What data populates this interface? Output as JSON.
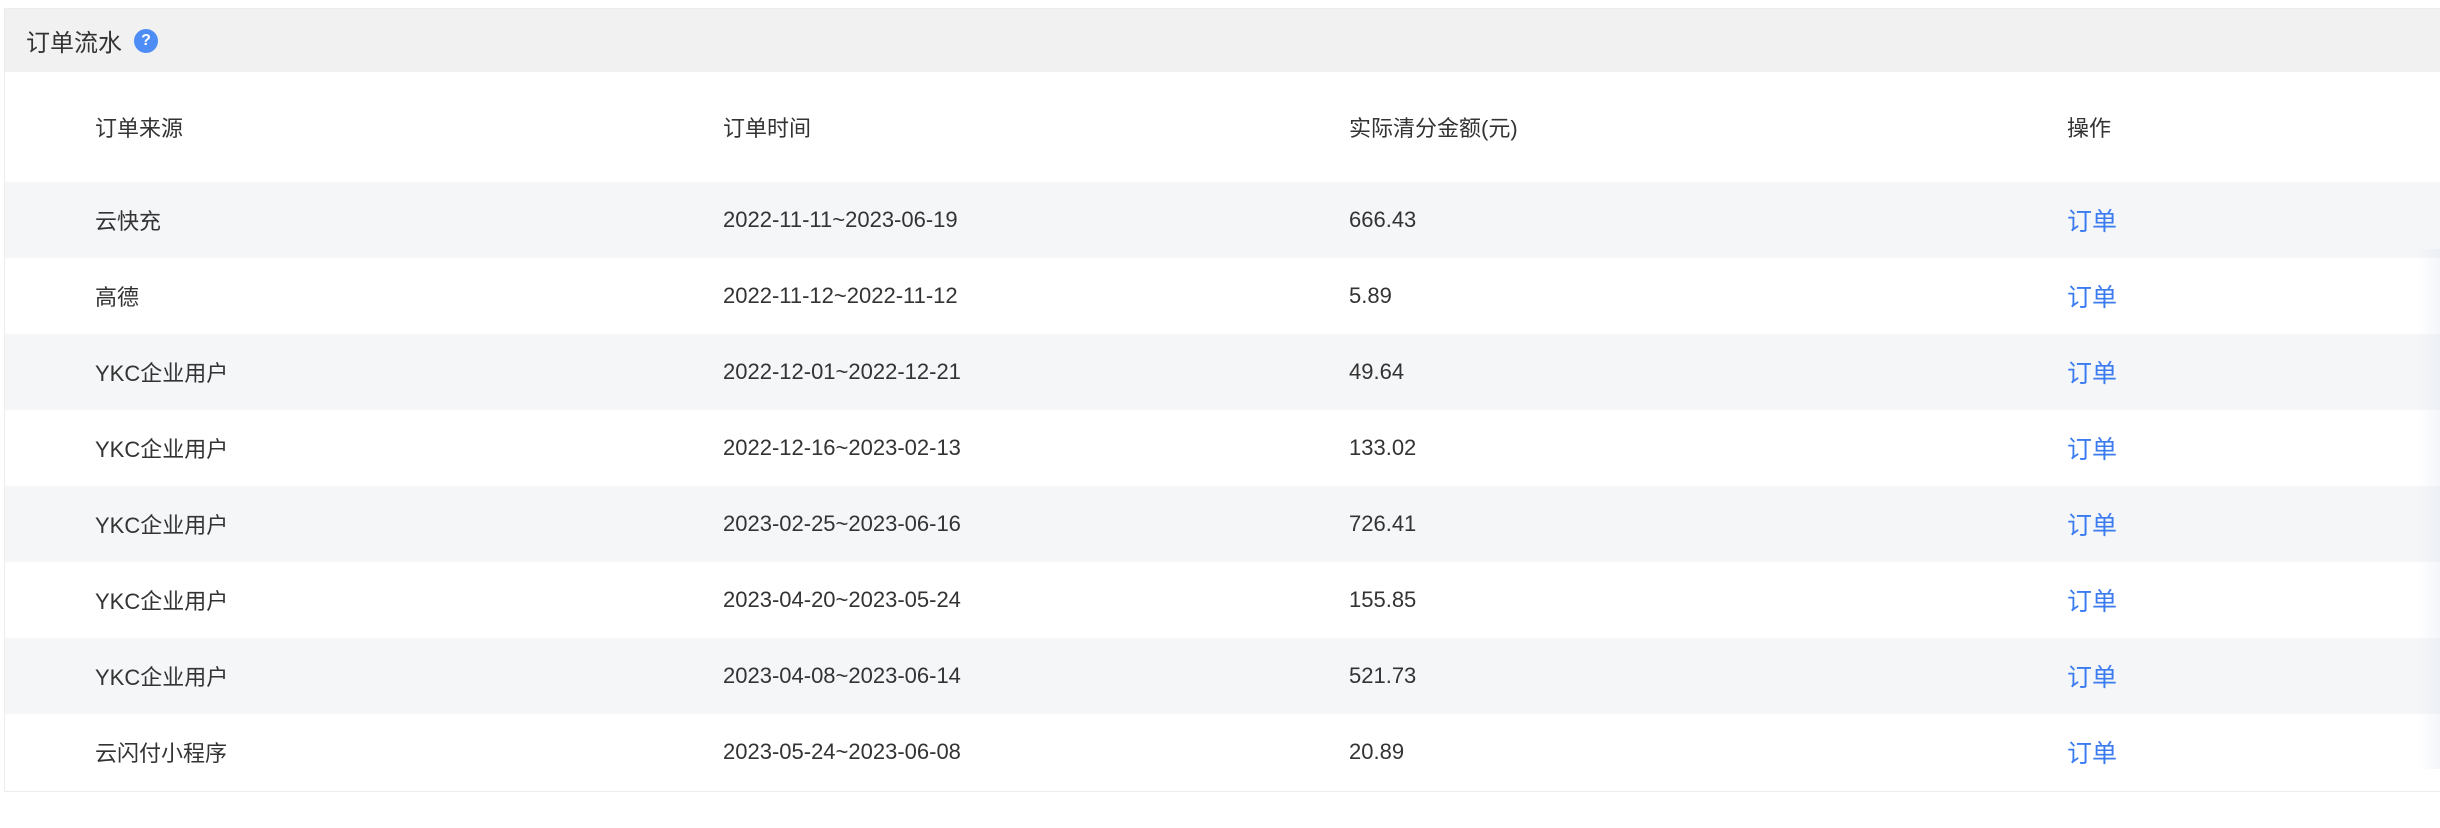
{
  "panel": {
    "title": "订单流水",
    "help_icon": "question-circle-icon",
    "accent_color": "#4e8cf6"
  },
  "table": {
    "headers": {
      "source": "订单来源",
      "time": "订单时间",
      "amount": "实际清分金额(元)",
      "action": "操作"
    },
    "rows": [
      {
        "source": "云快充",
        "time": "2022-11-11~2023-06-19",
        "amount": "666.43",
        "action": "订单"
      },
      {
        "source": "高德",
        "time": "2022-11-12~2022-11-12",
        "amount": "5.89",
        "action": "订单"
      },
      {
        "source": "YKC企业用户",
        "time": "2022-12-01~2022-12-21",
        "amount": "49.64",
        "action": "订单"
      },
      {
        "source": "YKC企业用户",
        "time": "2022-12-16~2023-02-13",
        "amount": "133.02",
        "action": "订单"
      },
      {
        "source": "YKC企业用户",
        "time": "2023-02-25~2023-06-16",
        "amount": "726.41",
        "action": "订单"
      },
      {
        "source": "YKC企业用户",
        "time": "2023-04-20~2023-05-24",
        "amount": "155.85",
        "action": "订单"
      },
      {
        "source": "YKC企业用户",
        "time": "2023-04-08~2023-06-14",
        "amount": "521.73",
        "action": "订单"
      },
      {
        "source": "云闪付小程序",
        "time": "2023-05-24~2023-06-08",
        "amount": "20.89",
        "action": "订单"
      }
    ],
    "link_color": "#3a7bf0",
    "stripe_color": "#f5f6f8"
  }
}
